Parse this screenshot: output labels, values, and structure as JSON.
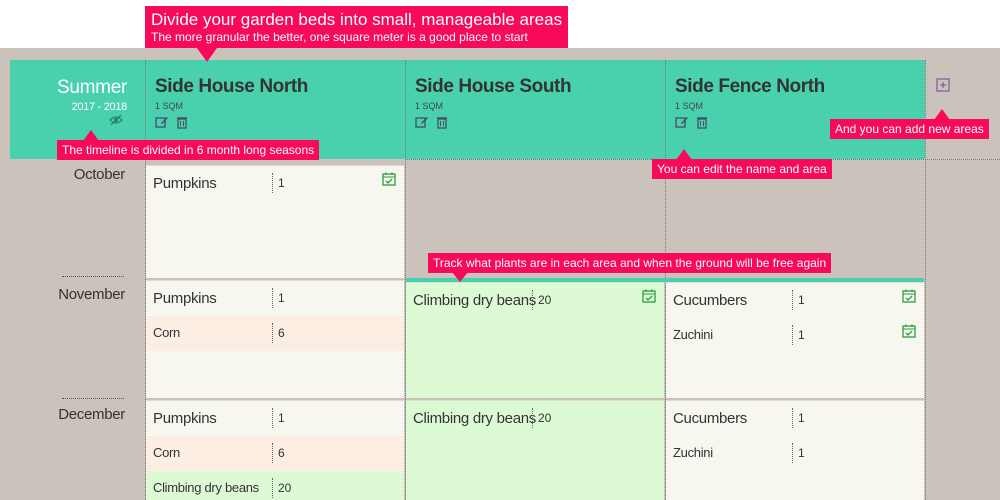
{
  "season": {
    "name": "Summer",
    "years": "2017 - 2018"
  },
  "areas": [
    {
      "name": "Side House North",
      "size": "1 SQM"
    },
    {
      "name": "Side House South",
      "size": "1 SQM"
    },
    {
      "name": "Side Fence North",
      "size": "1 SQM"
    }
  ],
  "months": [
    "October",
    "November",
    "December"
  ],
  "cells": {
    "oct_north": [
      {
        "name": "Pumpkins",
        "qty": "1"
      }
    ],
    "nov_north": [
      {
        "name": "Pumpkins",
        "qty": "1"
      },
      {
        "name": "Corn",
        "qty": "6"
      }
    ],
    "nov_south": [
      {
        "name": "Climbing dry beans",
        "qty": "20"
      }
    ],
    "nov_fence": [
      {
        "name": "Cucumbers",
        "qty": "1"
      },
      {
        "name": "Zuchini",
        "qty": "1"
      }
    ],
    "dec_north": [
      {
        "name": "Pumpkins",
        "qty": "1"
      },
      {
        "name": "Corn",
        "qty": "6"
      },
      {
        "name": "Climbing dry beans",
        "qty": "20"
      }
    ],
    "dec_south": [
      {
        "name": "Climbing dry beans",
        "qty": "20"
      }
    ],
    "dec_fence": [
      {
        "name": "Cucumbers",
        "qty": "1"
      },
      {
        "name": "Zuchini",
        "qty": "1"
      }
    ]
  },
  "hints": {
    "top_title": "Divide your garden beds into small, manageable areas",
    "top_sub": "The more granular the better, one square meter is a good place to start",
    "timeline": "The timeline is divided in 6 month long seasons",
    "edit": "You can edit the name and area",
    "add": "And you can add new areas",
    "track": "Track what plants are in each area and when the ground will be free again"
  },
  "colors": {
    "accent": "#48d1ac",
    "callout": "#f70a5a",
    "background": "#cbc2bc"
  }
}
